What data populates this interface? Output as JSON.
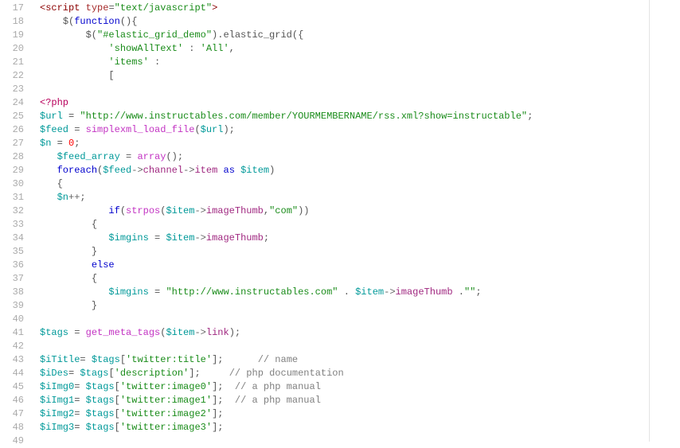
{
  "lines": [
    {
      "num": "17",
      "html": "<span class='tok-tag'>&lt;script</span><span class='tok-plain'> </span><span class='tok-attr'>type</span><span class='tok-plain'>=</span><span class='tok-string'>\"text/javascript\"</span><span class='tok-tag'>&gt;</span>"
    },
    {
      "num": "18",
      "html": "    <span class='tok-plain'>$(</span><span class='tok-keyword'>function</span><span class='tok-plain'>(){</span>"
    },
    {
      "num": "19",
      "html": "        <span class='tok-plain'>$(</span><span class='tok-string'>\"#elastic_grid_demo\"</span><span class='tok-plain'>).elastic_grid({</span>"
    },
    {
      "num": "20",
      "html": "            <span class='tok-string'>'showAllText'</span><span class='tok-plain'> : </span><span class='tok-string'>'All'</span><span class='tok-plain'>,</span>"
    },
    {
      "num": "21",
      "html": "            <span class='tok-string'>'items'</span><span class='tok-plain'> :</span>"
    },
    {
      "num": "22",
      "html": "            <span class='tok-plain'>[</span>"
    },
    {
      "num": "23",
      "html": ""
    },
    {
      "num": "24",
      "html": "<span class='tok-php'>&lt;?php</span>"
    },
    {
      "num": "25",
      "html": "<span class='tok-var'>$url</span><span class='tok-plain'> = </span><span class='tok-string'>\"http://www.instructables.com/member/YOURMEMBERNAME/rss.xml?show=instructable\"</span><span class='tok-plain'>;</span>"
    },
    {
      "num": "26",
      "html": "<span class='tok-var'>$feed</span><span class='tok-plain'> = </span><span class='tok-func'>simplexml_load_file</span><span class='tok-plain'>(</span><span class='tok-var'>$url</span><span class='tok-plain'>);</span>"
    },
    {
      "num": "27",
      "html": "<span class='tok-var'>$n</span><span class='tok-plain'> = </span><span class='tok-num'>0</span><span class='tok-plain'>;</span>"
    },
    {
      "num": "28",
      "html": "   <span class='tok-var'>$feed_array</span><span class='tok-plain'> = </span><span class='tok-func'>array</span><span class='tok-plain'>();</span>"
    },
    {
      "num": "29",
      "html": "   <span class='tok-keyword'>foreach</span><span class='tok-plain'>(</span><span class='tok-var'>$feed</span><span class='tok-op'>-&gt;</span><span class='tok-prop'>channel</span><span class='tok-op'>-&gt;</span><span class='tok-prop'>item</span><span class='tok-plain'> </span><span class='tok-keyword'>as</span><span class='tok-plain'> </span><span class='tok-var'>$item</span><span class='tok-plain'>)</span>"
    },
    {
      "num": "30",
      "html": "   <span class='tok-plain'>{</span>"
    },
    {
      "num": "31",
      "html": "   <span class='tok-var'>$n</span><span class='tok-op'>++</span><span class='tok-plain'>;</span>"
    },
    {
      "num": "32",
      "html": "            <span class='tok-keyword'>if</span><span class='tok-plain'>(</span><span class='tok-func'>strpos</span><span class='tok-plain'>(</span><span class='tok-var'>$item</span><span class='tok-op'>-&gt;</span><span class='tok-prop'>imageThumb</span><span class='tok-plain'>,</span><span class='tok-string'>\"com\"</span><span class='tok-plain'>))</span>"
    },
    {
      "num": "33",
      "html": "         <span class='tok-plain'>{</span>"
    },
    {
      "num": "34",
      "html": "            <span class='tok-var'>$imgins</span><span class='tok-plain'> = </span><span class='tok-var'>$item</span><span class='tok-op'>-&gt;</span><span class='tok-prop'>imageThumb</span><span class='tok-plain'>;</span>"
    },
    {
      "num": "35",
      "html": "         <span class='tok-plain'>}</span>"
    },
    {
      "num": "36",
      "html": "         <span class='tok-keyword'>else</span>"
    },
    {
      "num": "37",
      "html": "         <span class='tok-plain'>{</span>"
    },
    {
      "num": "38",
      "html": "            <span class='tok-var'>$imgins</span><span class='tok-plain'> = </span><span class='tok-string'>\"http://www.instructables.com\"</span><span class='tok-plain'> . </span><span class='tok-var'>$item</span><span class='tok-op'>-&gt;</span><span class='tok-prop'>imageThumb</span><span class='tok-plain'> .</span><span class='tok-string'>\"\"</span><span class='tok-plain'>;</span>"
    },
    {
      "num": "39",
      "html": "         <span class='tok-plain'>}</span>"
    },
    {
      "num": "40",
      "html": ""
    },
    {
      "num": "41",
      "html": "<span class='tok-var'>$tags</span><span class='tok-plain'> = </span><span class='tok-func'>get_meta_tags</span><span class='tok-plain'>(</span><span class='tok-var'>$item</span><span class='tok-op'>-&gt;</span><span class='tok-prop'>link</span><span class='tok-plain'>);</span>"
    },
    {
      "num": "42",
      "html": ""
    },
    {
      "num": "43",
      "html": "<span class='tok-var'>$iTitle</span><span class='tok-plain'>= </span><span class='tok-var'>$tags</span><span class='tok-plain'>[</span><span class='tok-string'>'twitter:title'</span><span class='tok-plain'>];      </span><span class='tok-comment'>// name</span>"
    },
    {
      "num": "44",
      "html": "<span class='tok-var'>$iDes</span><span class='tok-plain'>= </span><span class='tok-var'>$tags</span><span class='tok-plain'>[</span><span class='tok-string'>'description'</span><span class='tok-plain'>];     </span><span class='tok-comment'>// php documentation</span>"
    },
    {
      "num": "45",
      "html": "<span class='tok-var'>$iImg0</span><span class='tok-plain'>= </span><span class='tok-var'>$tags</span><span class='tok-plain'>[</span><span class='tok-string'>'twitter:image0'</span><span class='tok-plain'>];  </span><span class='tok-comment'>// a php manual</span>"
    },
    {
      "num": "46",
      "html": "<span class='tok-var'>$iImg1</span><span class='tok-plain'>= </span><span class='tok-var'>$tags</span><span class='tok-plain'>[</span><span class='tok-string'>'twitter:image1'</span><span class='tok-plain'>];  </span><span class='tok-comment'>// a php manual</span>"
    },
    {
      "num": "47",
      "html": "<span class='tok-var'>$iImg2</span><span class='tok-plain'>= </span><span class='tok-var'>$tags</span><span class='tok-plain'>[</span><span class='tok-string'>'twitter:image2'</span><span class='tok-plain'>];</span>"
    },
    {
      "num": "48",
      "html": "<span class='tok-var'>$iImg3</span><span class='tok-plain'>= </span><span class='tok-var'>$tags</span><span class='tok-plain'>[</span><span class='tok-string'>'twitter:image3'</span><span class='tok-plain'>];</span>"
    },
    {
      "num": "49",
      "html": ""
    }
  ]
}
